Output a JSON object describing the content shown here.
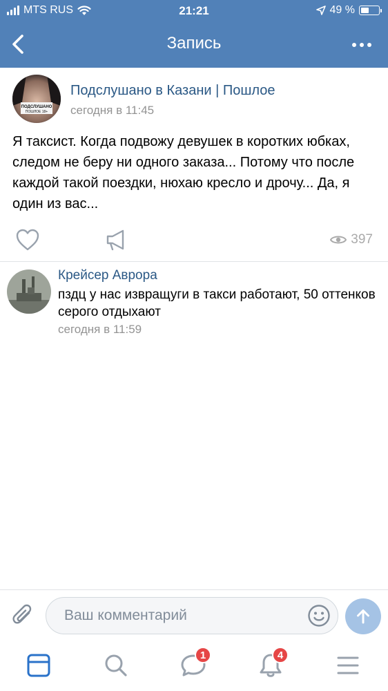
{
  "status_bar": {
    "carrier": "MTS RUS",
    "time": "21:21",
    "battery": "49 %",
    "battery_level": 0.49
  },
  "nav": {
    "title": "Запись",
    "back_icon": "chevron-left-icon",
    "more_icon": "more-horizontal-icon"
  },
  "post": {
    "author": "Подслушано в Казани | Пошлое",
    "time": "сегодня в 11:45",
    "avatar_caption": "ПОДСЛУШАНО\nПОШЛОЕ 18+",
    "text": "Я таксист. Когда подвожу девушек в коротких юбках, следом не беру ни одного заказа... Потому что после каждой такой поездки, нюхаю кресло и дрочу... Да, я один из вас...",
    "views": "397"
  },
  "comment": {
    "author": "Крейсер Аврора",
    "text": "пздц у нас извращуги в такси работают, 50 оттенков серого отдыхают",
    "time": "сегодня в 11:59"
  },
  "composer": {
    "placeholder": "Ваш комментарий"
  },
  "tabbar": {
    "messages_badge": "1",
    "notifications_badge": "4"
  },
  "colors": {
    "header": "#5181b8",
    "link": "#2a5885",
    "secondary_text": "#939393",
    "badge": "#e64646",
    "send_button": "#a5c3e5"
  }
}
